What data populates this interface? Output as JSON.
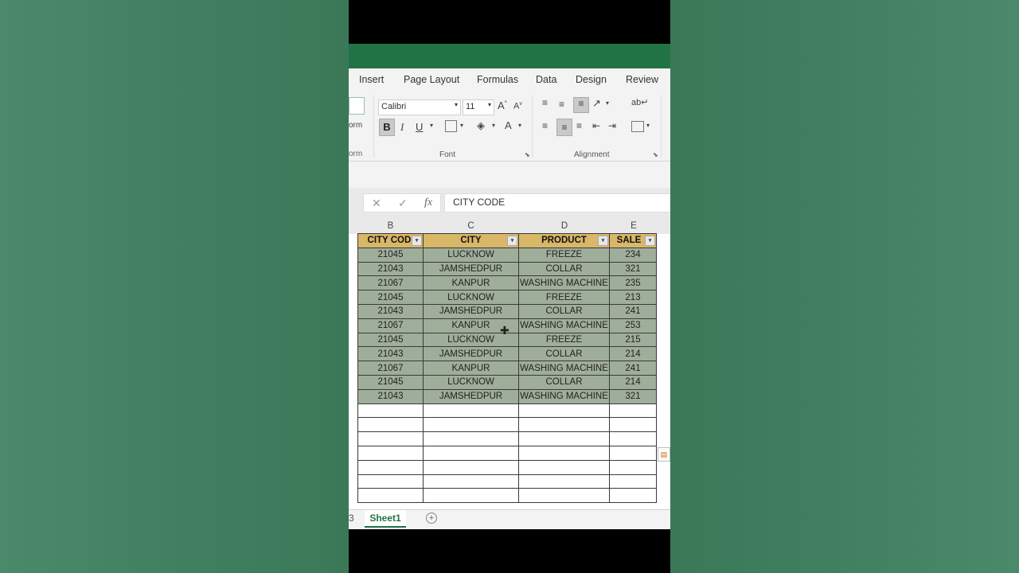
{
  "ribbon_tabs": [
    "Insert",
    "Page Layout",
    "Formulas",
    "Data",
    "Design",
    "Review"
  ],
  "font": {
    "name": "Calibri",
    "size": "11",
    "group_label": "Font"
  },
  "alignment": {
    "group_label": "Alignment"
  },
  "left_cut": {
    "form_label": "orm",
    "form_label2": "orm"
  },
  "formula_bar": {
    "cancel": "✕",
    "enter": "✓",
    "fx": "fx",
    "value": "CITY CODE"
  },
  "columns": [
    "B",
    "C",
    "D",
    "E"
  ],
  "table": {
    "headers": [
      "CITY CODI",
      "CITY",
      "PRODUCT",
      "SALE"
    ],
    "rows": [
      [
        "21045",
        "LUCKNOW",
        "FREEZE",
        "234"
      ],
      [
        "21043",
        "JAMSHEDPUR",
        "COLLAR",
        "321"
      ],
      [
        "21067",
        "KANPUR",
        "WASHING MACHINE",
        "235"
      ],
      [
        "21045",
        "LUCKNOW",
        "FREEZE",
        "213"
      ],
      [
        "21043",
        "JAMSHEDPUR",
        "COLLAR",
        "241"
      ],
      [
        "21067",
        "KANPUR",
        "WASHING MACHINE",
        "253"
      ],
      [
        "21045",
        "LUCKNOW",
        "FREEZE",
        "215"
      ],
      [
        "21043",
        "JAMSHEDPUR",
        "COLLAR",
        "214"
      ],
      [
        "21067",
        "KANPUR",
        "WASHING MACHINE",
        "241"
      ],
      [
        "21045",
        "LUCKNOW",
        "COLLAR",
        "214"
      ],
      [
        "21043",
        "JAMSHEDPUR",
        "WASHING MACHINE",
        "321"
      ]
    ]
  },
  "sheets": {
    "prev": "3",
    "active": "Sheet1",
    "add": "+"
  },
  "colors": {
    "accent": "#217346",
    "header_fill": "#d9b768",
    "selection_fill": "#9fae9a"
  }
}
